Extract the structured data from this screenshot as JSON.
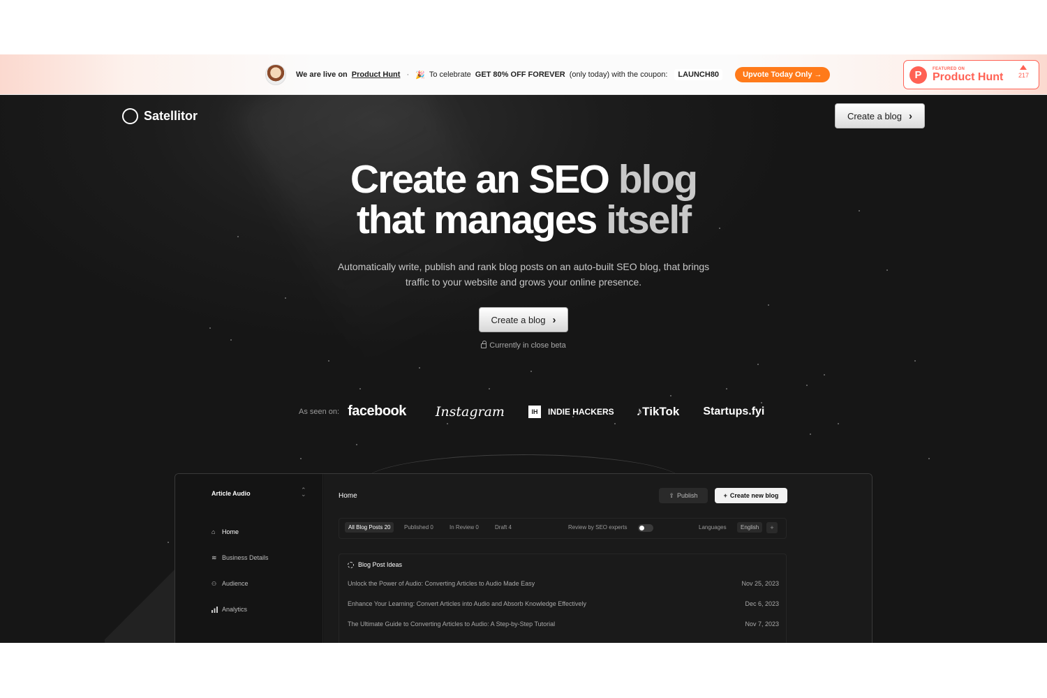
{
  "banner": {
    "live_prefix": "We are live on",
    "live_link": "Product Hunt",
    "separator": "·",
    "emoji": "🎉",
    "celebrate_prefix": "To celebrate",
    "offer": "GET 80% OFF FOREVER",
    "offer_suffix": "(only today) with the coupon:",
    "coupon": "LAUNCH80",
    "upvote_label": "Upvote Today Only →"
  },
  "ph_badge": {
    "small": "FEATURED ON",
    "big": "Product Hunt",
    "letter": "P",
    "count": "217"
  },
  "nav": {
    "brand": "Satellitor",
    "cta_label": "Create a blog",
    "cta_chevron": "›"
  },
  "hero": {
    "headline_line1_a": "Create an SEO",
    "headline_line1_b": "blog",
    "headline_line2_a": "that manages",
    "headline_line2_b": "itself",
    "subtitle": "Automatically write, publish and rank blog posts on an auto-built SEO blog, that brings traffic to your website and grows your online presence.",
    "cta_label": "Create a blog",
    "cta_chevron": "›",
    "beta_note": "Currently in close beta"
  },
  "seen_on": {
    "label": "As seen on:",
    "logos": {
      "facebook": "facebook",
      "instagram": "Instagram",
      "indie_hackers_box": "IH",
      "indie_hackers": "INDIE HACKERS",
      "tiktok": "TikTok",
      "startups": "Startups.fyi"
    }
  },
  "app": {
    "workspace": "Article Audio",
    "workspace_chevron": "⌃⌄",
    "sidebar": [
      {
        "label": "Home",
        "icon": "home-icon",
        "glyph": "⌂"
      },
      {
        "label": "Business Details",
        "icon": "layers-icon",
        "glyph": "≋"
      },
      {
        "label": "Audience",
        "icon": "users-icon",
        "glyph": "👥"
      },
      {
        "label": "Analytics",
        "icon": "bar-chart-icon",
        "glyph": "▮"
      }
    ],
    "title": "Home",
    "publish_label": "Publish",
    "publish_glyph": "⇪",
    "create_label": "Create new blog",
    "create_glyph": "+",
    "tabs": {
      "all": "All Blog Posts 20",
      "published": "Published 0",
      "in_review": "In Review 0",
      "draft": "Draft 4"
    },
    "review_label": "Review by SEO experts",
    "review_enabled": false,
    "languages_label": "Languages",
    "language_value": "English",
    "language_add": "+",
    "ideas_title": "Blog Post Ideas",
    "ideas": [
      {
        "title": "Unlock the Power of Audio: Converting Articles to Audio Made Easy",
        "date": "Nov 25, 2023"
      },
      {
        "title": "Enhance Your Learning: Convert Articles into Audio and Absorb Knowledge Effectively",
        "date": "Dec 6, 2023"
      },
      {
        "title": "The Ultimate Guide to Converting Articles to Audio: A Step-by-Step Tutorial",
        "date": "Nov 7, 2023"
      }
    ]
  },
  "colors": {
    "accent_orange": "#ff7a1a",
    "product_hunt": "#ff6154",
    "hero_bg": "#1a1a1a"
  }
}
